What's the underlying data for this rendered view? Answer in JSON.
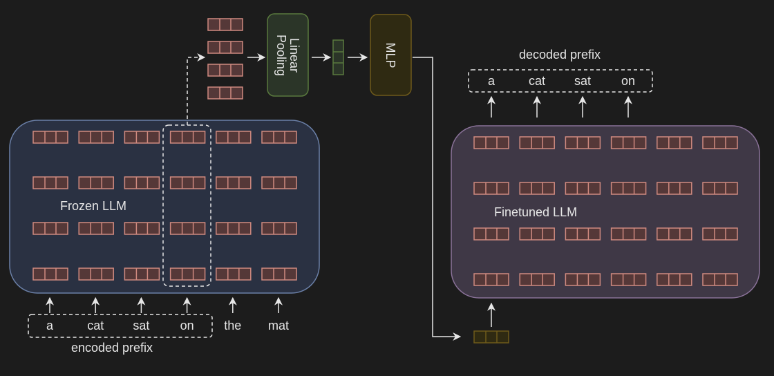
{
  "frozen_llm": {
    "label": "Frozen LLM",
    "rows": 4,
    "cols": 6
  },
  "finetuned_llm": {
    "label": "Finetuned LLM",
    "rows": 4,
    "cols": 6
  },
  "linear_pooling": {
    "label_line1": "Linear",
    "label_line2": "Pooling"
  },
  "mlp": {
    "label": "MLP"
  },
  "encoded_prefix": {
    "title": "encoded prefix",
    "tokens": [
      "a",
      "cat",
      "sat",
      "on"
    ]
  },
  "input_tokens_extra": [
    "the",
    "mat"
  ],
  "decoded_prefix": {
    "title": "decoded prefix",
    "tokens": [
      "a",
      "cat",
      "sat",
      "on"
    ]
  },
  "colors": {
    "background": "#1c1c1c",
    "token_fill": "#553838",
    "token_stroke": "#d08a80",
    "frozen_fill": "#2a3142",
    "frozen_stroke": "#6b80a8",
    "finetuned_fill": "#3f3846",
    "finetuned_stroke": "#8a7299",
    "pooling_fill": "#2b3528",
    "pooling_stroke": "#5a7a3e",
    "mlp_fill": "#2f2a12",
    "mlp_stroke": "#6e5a1b"
  }
}
